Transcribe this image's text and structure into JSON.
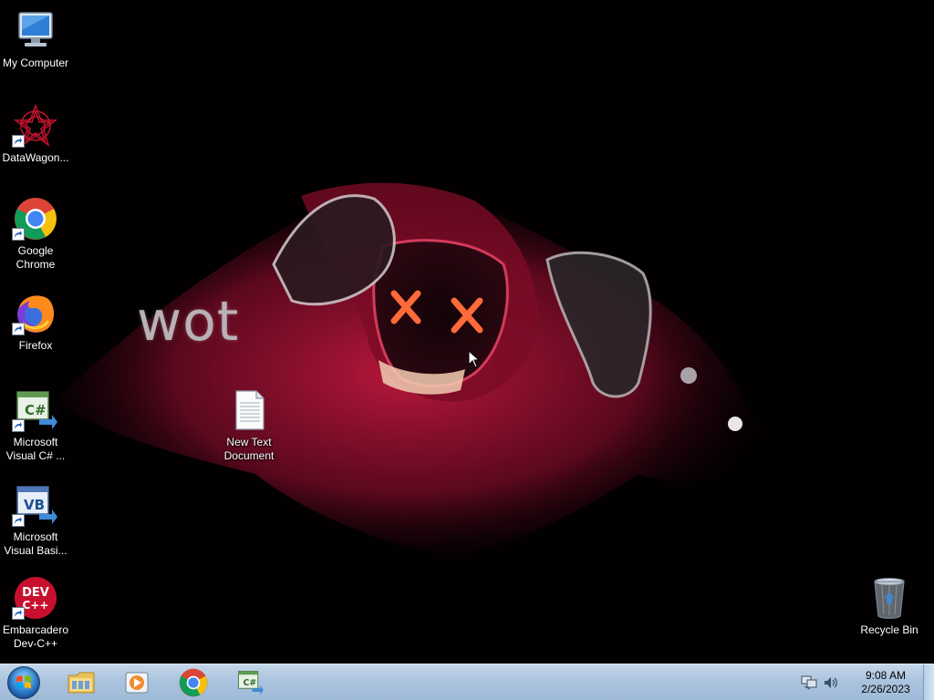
{
  "wallpaper": {
    "overlay_text": "wot"
  },
  "desktop_icons": [
    {
      "id": "my-computer",
      "label": "My Computer",
      "icon": "computer-icon",
      "shortcut": false
    },
    {
      "id": "datawagon",
      "label": "DataWagon...",
      "icon": "datawagon-icon",
      "shortcut": true
    },
    {
      "id": "google-chrome",
      "label": "Google Chrome",
      "icon": "chrome-icon",
      "shortcut": true
    },
    {
      "id": "firefox",
      "label": "Firefox",
      "icon": "firefox-icon",
      "shortcut": true
    },
    {
      "id": "ms-visual-csharp",
      "label": "Microsoft Visual C# ...",
      "icon": "visual-csharp-icon",
      "shortcut": true
    },
    {
      "id": "new-text-document",
      "label": "New Text Document",
      "icon": "text-document-icon",
      "shortcut": false
    },
    {
      "id": "ms-visual-basic",
      "label": "Microsoft Visual Basi...",
      "icon": "visual-basic-icon",
      "shortcut": true
    },
    {
      "id": "embarcadero-devcpp",
      "label": "Embarcadero Dev-C++",
      "icon": "devcpp-icon",
      "shortcut": true
    },
    {
      "id": "recycle-bin",
      "label": "Recycle Bin",
      "icon": "recycle-bin-icon",
      "shortcut": false
    }
  ],
  "taskbar": {
    "start_icon": "windows-logo-icon",
    "pinned": [
      {
        "id": "explorer",
        "icon": "folder-icon"
      },
      {
        "id": "media-player",
        "icon": "media-player-icon"
      },
      {
        "id": "chrome",
        "icon": "chrome-icon"
      },
      {
        "id": "visual-csharp",
        "icon": "visual-csharp-icon"
      }
    ],
    "tray_icons": [
      "network-icon",
      "volume-icon"
    ],
    "clock": {
      "time": "9:08 AM",
      "date": "2/26/2023"
    }
  },
  "colors": {
    "taskbar": "#a9c3de",
    "desktop_bg": "#020001",
    "wallpaper_accent": "#c2183f"
  }
}
